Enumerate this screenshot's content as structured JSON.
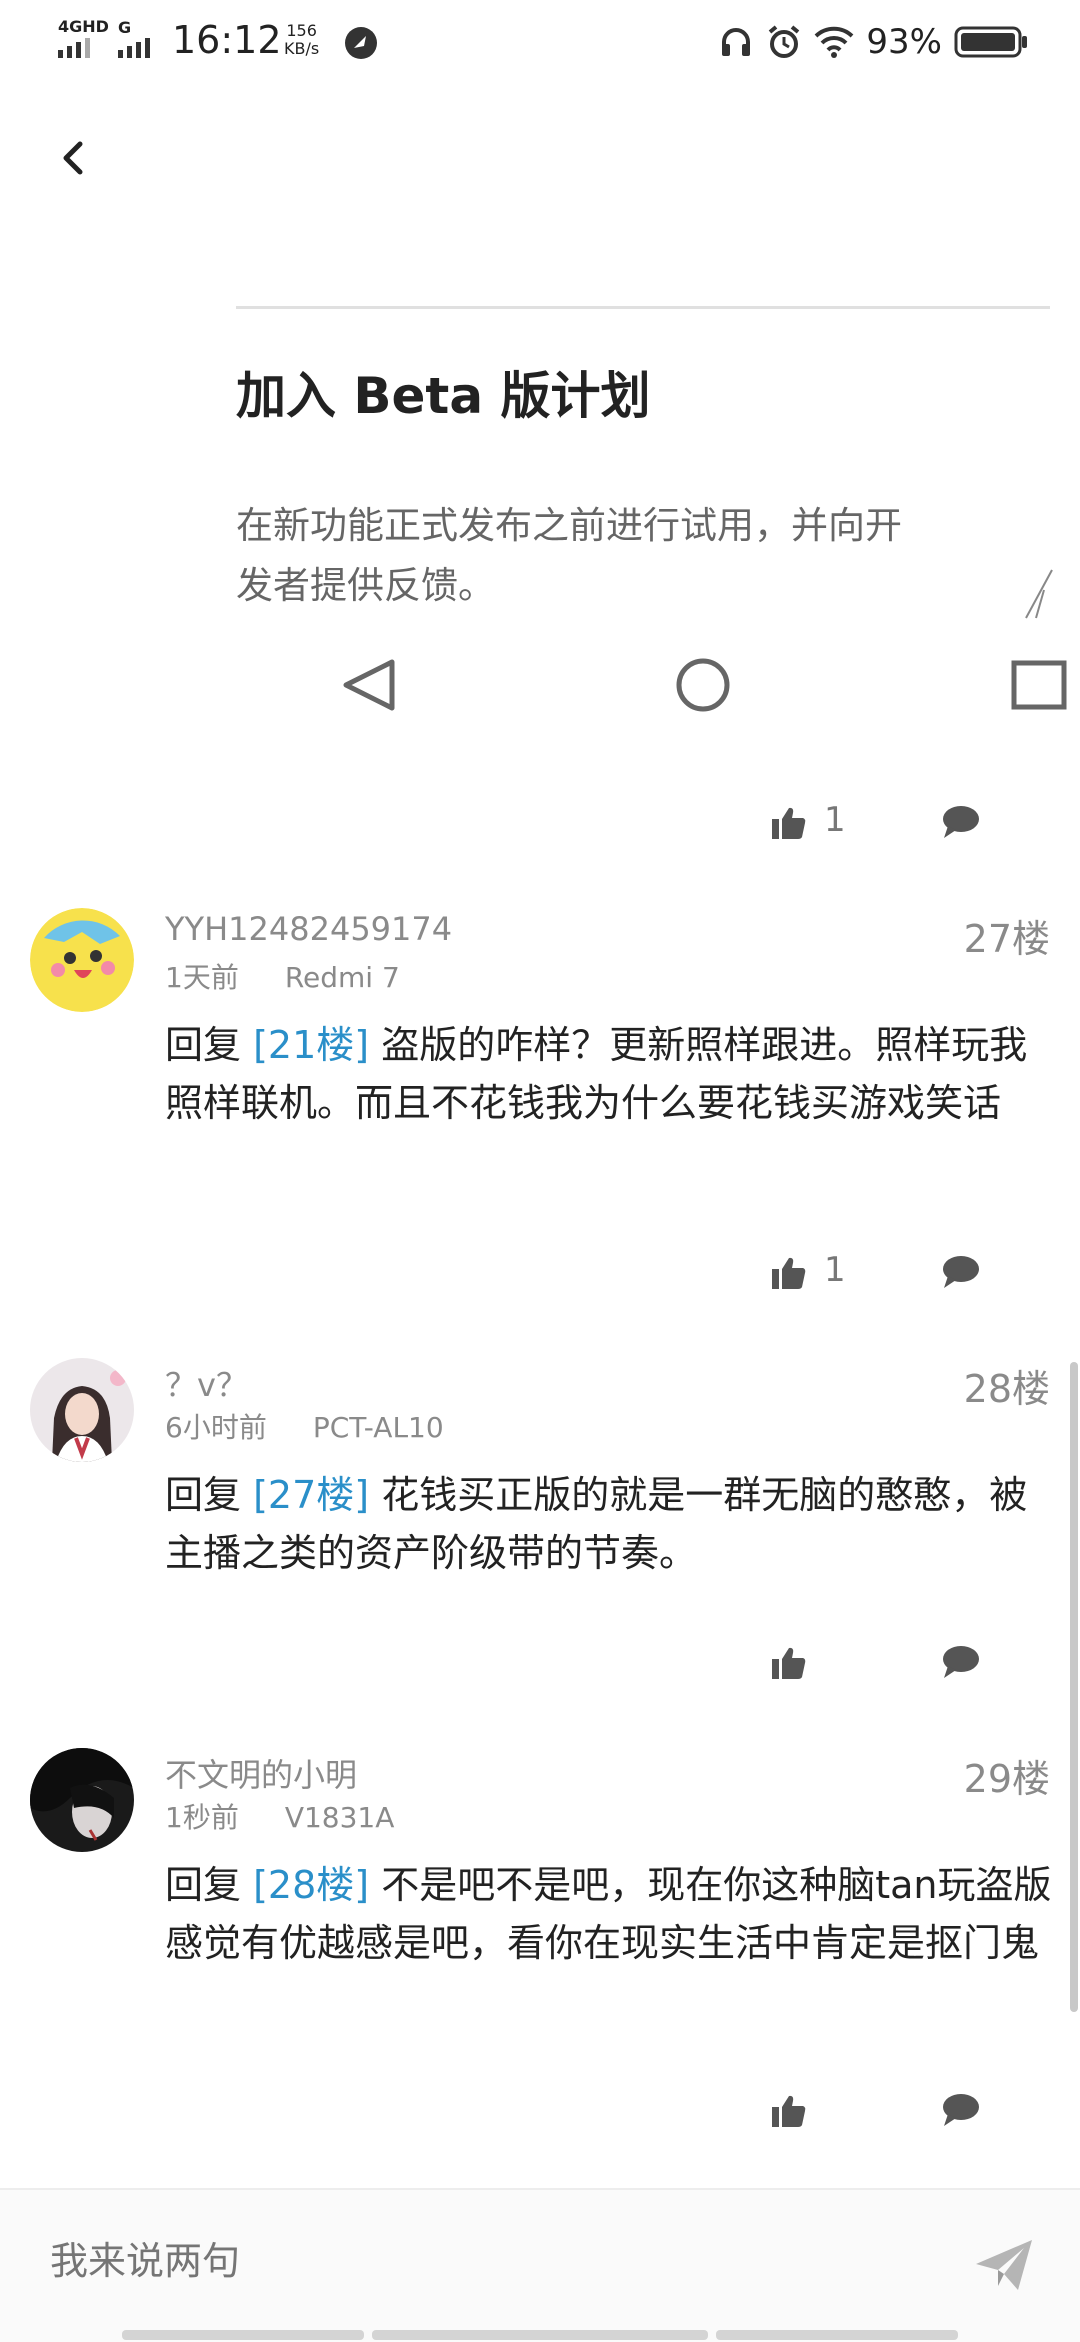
{
  "status_bar": {
    "network": "4GHD",
    "network2": "G",
    "time": "16:12",
    "speed_value": "156",
    "speed_unit": "KB/s",
    "battery": "93%"
  },
  "embedded_screenshot": {
    "title": "加入 Beta 版计划",
    "description": "在新功能正式发布之前进行试用，并向开发者提供反馈。"
  },
  "top_actions": {
    "like_count": "1"
  },
  "comments": [
    {
      "username": "YYH12482459174",
      "time": "1天前",
      "device": "Redmi 7",
      "floor": "27楼",
      "prefix": "回复 ",
      "ref": "[21楼]",
      "text": " 盗版的咋样？更新照样跟进。照样玩我照样联机。而且不花钱我为什么要花钱买游戏笑话",
      "like_count": "1"
    },
    {
      "username": "？v？",
      "time": "6小时前",
      "device": "PCT-AL10",
      "floor": "28楼",
      "prefix": "回复 ",
      "ref": "[27楼]",
      "text": " 花钱买正版的就是一群无脑的憨憨，被主播之类的资产阶级带的节奏。",
      "like_count": ""
    },
    {
      "username": "不文明的小明",
      "time": "1秒前",
      "device": "V1831A",
      "floor": "29楼",
      "prefix": "回复 ",
      "ref": "[28楼]",
      "text": " 不是吧不是吧，现在你这种脑tan玩盗版感觉有优越感是吧，看你在现实生活中肯定是抠门鬼",
      "like_count": ""
    }
  ],
  "input": {
    "placeholder": "我来说两句"
  },
  "colors": {
    "link": "#2a8fc9",
    "muted": "#8a8a8a"
  },
  "icons": [
    "back-icon",
    "like-icon",
    "comment-icon",
    "send-icon",
    "headphones-icon",
    "alarm-icon",
    "wifi-icon",
    "battery-icon"
  ]
}
